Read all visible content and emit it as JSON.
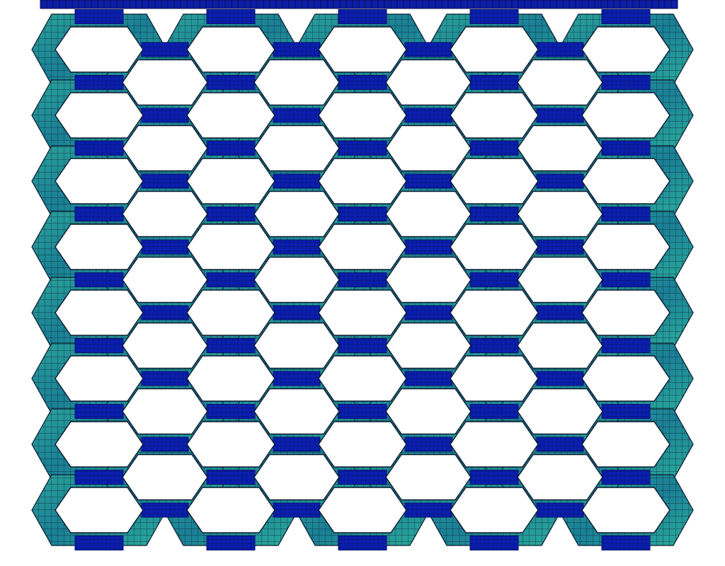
{
  "figure": {
    "kind": "finite-element mesh of a hexagonal honeycomb lattice under a top loading plate",
    "grid": {
      "rows_full_cells": 8,
      "cols_full_cells": 5,
      "rows_offset_cells": 7,
      "cols_offset_cells": 4
    },
    "colors": {
      "background": "#ffffff",
      "plate": "#0d1ea8",
      "plate_mesh": "#050a40",
      "wall_fill": "#1f8f9a",
      "wall_highlight": "#37b6a0",
      "wall_shadow": "#0f5f80",
      "connector": "#0a1fb0",
      "connector_dark": "#061170",
      "mesh_line": "#0a1a2e"
    }
  }
}
